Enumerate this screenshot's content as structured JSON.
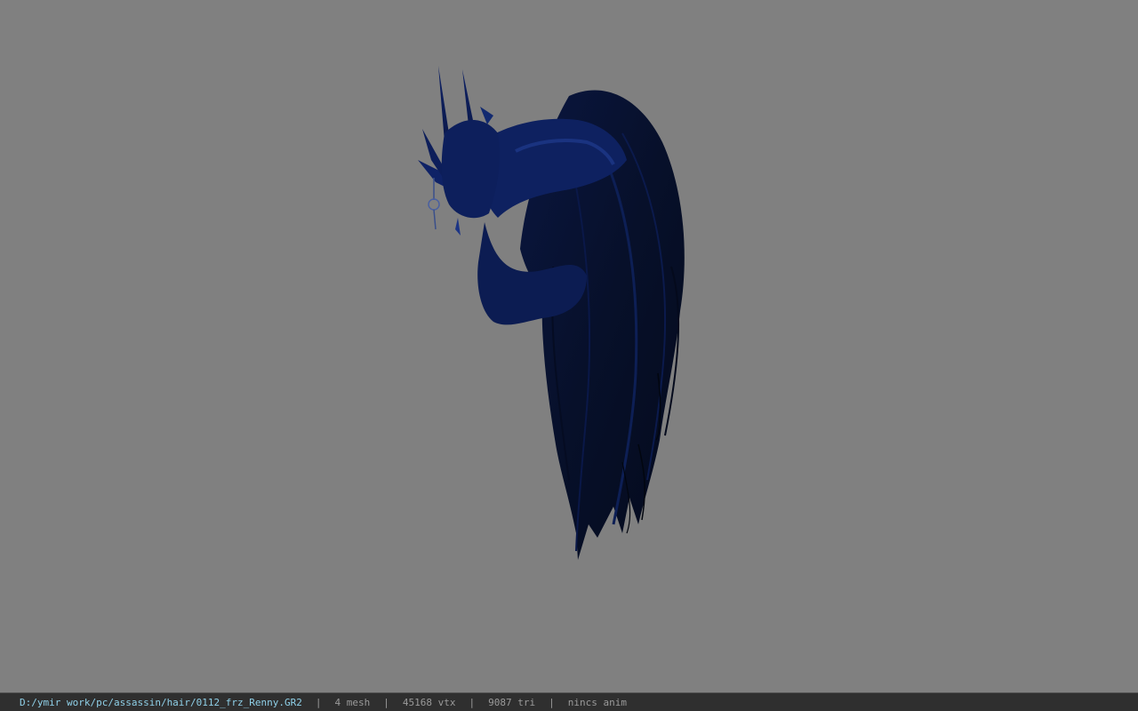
{
  "status_bar": {
    "file_path": "D:/ymir work/pc/assassin/hair/0112_frz_Renny.GR2",
    "separator": "|",
    "mesh_count": "4 mesh",
    "vertex_count": "45168 vtx",
    "triangle_count": "9087 tri",
    "animation": "nincs anim"
  },
  "viewport": {
    "background_color": "#808080",
    "model_color": "#0b1a3d"
  }
}
